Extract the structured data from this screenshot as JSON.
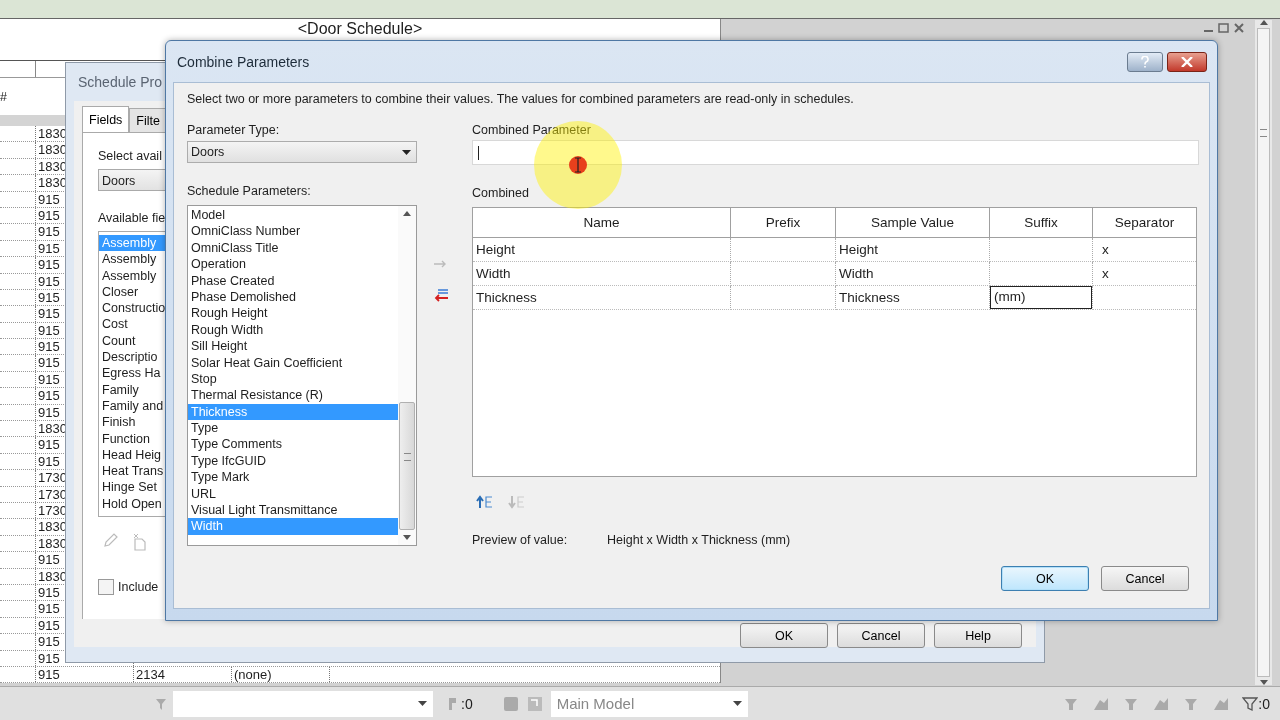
{
  "schedule": {
    "title": "<Door Schedule>",
    "header": "#",
    "rows": [
      {
        "cells": [
          "1830"
        ]
      },
      {
        "cells": [
          "1830"
        ]
      },
      {
        "cells": [
          "1830"
        ]
      },
      {
        "cells": [
          "1830"
        ]
      },
      {
        "cells": [
          "915"
        ]
      },
      {
        "cells": [
          "915"
        ]
      },
      {
        "cells": [
          "915"
        ]
      },
      {
        "cells": [
          "915"
        ]
      },
      {
        "cells": [
          "915"
        ]
      },
      {
        "cells": [
          "915"
        ]
      },
      {
        "cells": [
          "915"
        ]
      },
      {
        "cells": [
          "915"
        ]
      },
      {
        "cells": [
          "915"
        ]
      },
      {
        "cells": [
          "915"
        ]
      },
      {
        "cells": [
          "915"
        ]
      },
      {
        "cells": [
          "915"
        ]
      },
      {
        "cells": [
          "915"
        ]
      },
      {
        "cells": [
          "915"
        ]
      },
      {
        "cells": [
          "1830"
        ]
      },
      {
        "cells": [
          "915"
        ]
      },
      {
        "cells": [
          "915"
        ]
      },
      {
        "cells": [
          "1730"
        ]
      },
      {
        "cells": [
          "1730"
        ]
      },
      {
        "cells": [
          "1730"
        ]
      },
      {
        "cells": [
          "1830"
        ]
      },
      {
        "cells": [
          "1830"
        ]
      },
      {
        "cells": [
          "915"
        ]
      },
      {
        "cells": [
          "1830"
        ]
      },
      {
        "cells": [
          "915"
        ]
      },
      {
        "cells": [
          "915"
        ]
      },
      {
        "cells": [
          "915"
        ]
      },
      {
        "cells": [
          "915"
        ]
      },
      {
        "cells": [
          "915"
        ]
      },
      {
        "cells": [
          "915",
          "2134",
          "(none)"
        ]
      }
    ]
  },
  "schedule_properties": {
    "title": "Schedule Pro",
    "tabs": [
      {
        "label": "Fields",
        "selected": true
      },
      {
        "label": "Filte",
        "selected": false
      }
    ],
    "category_label": "Select avail",
    "category": "Doors",
    "fields_label": "Available fie",
    "fields": [
      {
        "label": "Assembly",
        "selected": true
      },
      {
        "label": "Assembly",
        "selected": false
      },
      {
        "label": "Assembly",
        "selected": false
      },
      {
        "label": "Closer",
        "selected": false
      },
      {
        "label": "Constructio",
        "selected": false
      },
      {
        "label": "Cost",
        "selected": false
      },
      {
        "label": "Count",
        "selected": false
      },
      {
        "label": "Descriptio",
        "selected": false
      },
      {
        "label": "Egress Ha",
        "selected": false
      },
      {
        "label": "Family",
        "selected": false
      },
      {
        "label": "Family and",
        "selected": false
      },
      {
        "label": "Finish",
        "selected": false
      },
      {
        "label": "Function",
        "selected": false
      },
      {
        "label": "Head Heig",
        "selected": false
      },
      {
        "label": "Heat Trans",
        "selected": false
      },
      {
        "label": "Hinge Set",
        "selected": false
      },
      {
        "label": "Hold Open",
        "selected": false
      }
    ],
    "include": {
      "label": "Include",
      "checked": false
    },
    "buttons": [
      "OK",
      "Cancel",
      "Help"
    ]
  },
  "dialog": {
    "title": "Combine Parameters",
    "description": "Select two or more parameters to combine their values.  The values for combined parameters are read-only in schedules.",
    "parameter_type_label": "Parameter Type:",
    "parameter_type": "Doors",
    "schedule_parameters_label": "Schedule Parameters:",
    "schedule_parameters": [
      {
        "label": "Model",
        "selected": false
      },
      {
        "label": "OmniClass Number",
        "selected": false
      },
      {
        "label": "OmniClass Title",
        "selected": false
      },
      {
        "label": "Operation",
        "selected": false
      },
      {
        "label": "Phase Created",
        "selected": false
      },
      {
        "label": "Phase Demolished",
        "selected": false
      },
      {
        "label": "Rough Height",
        "selected": false
      },
      {
        "label": "Rough Width",
        "selected": false
      },
      {
        "label": "Sill Height",
        "selected": false
      },
      {
        "label": "Solar Heat Gain Coefficient",
        "selected": false
      },
      {
        "label": "Stop",
        "selected": false
      },
      {
        "label": "Thermal Resistance (R)",
        "selected": false
      },
      {
        "label": "Thickness",
        "selected": true
      },
      {
        "label": "Type",
        "selected": false
      },
      {
        "label": "Type Comments",
        "selected": false
      },
      {
        "label": "Type IfcGUID",
        "selected": false
      },
      {
        "label": "Type Mark",
        "selected": false
      },
      {
        "label": "URL",
        "selected": false
      },
      {
        "label": "Visual Light Transmittance",
        "selected": false
      },
      {
        "label": "Width",
        "selected": true
      }
    ],
    "combined_parameter_label": "Combined Parameter",
    "combined_label": "Combined",
    "columns": [
      "Name",
      "Prefix",
      "Sample Value",
      "Suffix",
      "Separator"
    ],
    "rows": [
      {
        "name": "Height",
        "sample": "Height",
        "suffix": "",
        "separator": "x",
        "editing": false
      },
      {
        "name": "Width",
        "sample": "Width",
        "suffix": "",
        "separator": "x",
        "editing": false
      },
      {
        "name": "Thickness",
        "sample": "Thickness",
        "suffix": "(mm)",
        "separator": "",
        "editing": true
      }
    ],
    "preview_label": "Preview of value:",
    "preview": "Height x Width x Thickness (mm)",
    "buttons": [
      "OK",
      "Cancel"
    ]
  },
  "status_bar": {
    "selection_count": ":0",
    "model": "Main Model",
    "filter_count": ":0"
  }
}
